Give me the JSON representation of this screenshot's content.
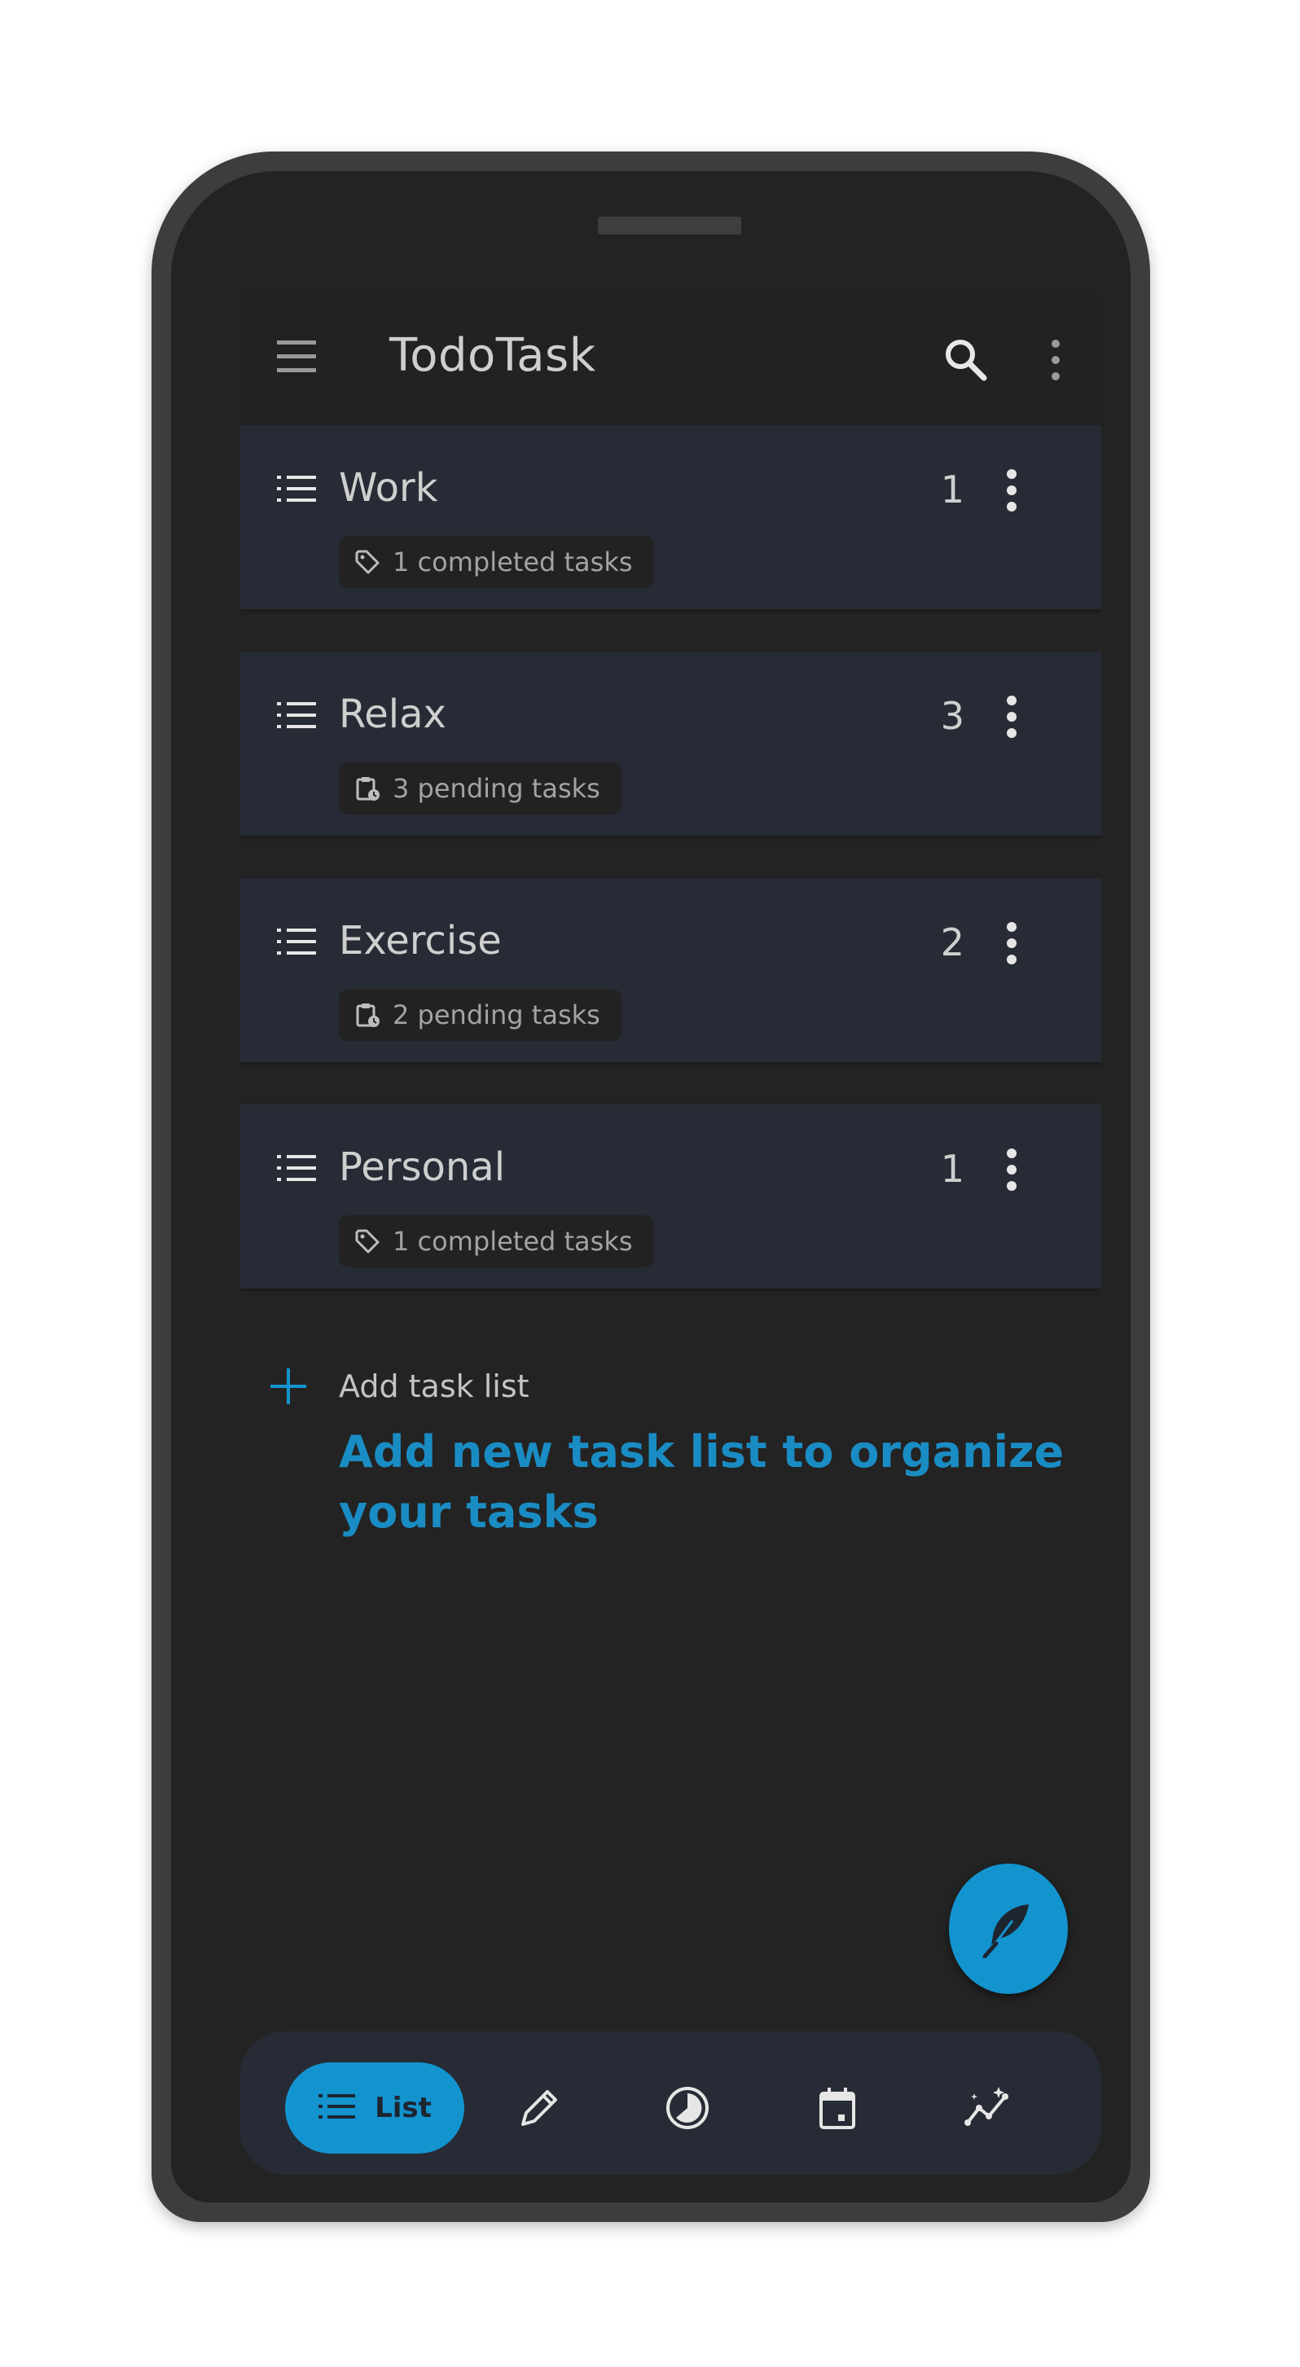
{
  "app": {
    "title": "TodoTask"
  },
  "lists": [
    {
      "name": "Work",
      "count": "1",
      "status_label": "1 completed tasks",
      "status_icon": "tag-icon"
    },
    {
      "name": "Relax",
      "count": "3",
      "status_label": "3 pending tasks",
      "status_icon": "pending-clipboard-icon"
    },
    {
      "name": "Exercise",
      "count": "2",
      "status_label": "2 pending tasks",
      "status_icon": "pending-clipboard-icon"
    },
    {
      "name": "Personal",
      "count": "1",
      "status_label": "1 completed tasks",
      "status_icon": "tag-icon"
    }
  ],
  "add_list": {
    "label": "Add task list",
    "description": "Add new task list to organize your tasks"
  },
  "bottom_nav": {
    "items": [
      {
        "label": "List",
        "icon": "list-icon",
        "active": true
      },
      {
        "label": "",
        "icon": "pencil-icon",
        "active": false
      },
      {
        "label": "",
        "icon": "pie-chart-icon",
        "active": false
      },
      {
        "label": "",
        "icon": "calendar-icon",
        "active": false
      },
      {
        "label": "",
        "icon": "sparkle-chart-icon",
        "active": false
      }
    ]
  },
  "fab": {
    "icon": "feather-icon"
  },
  "colors": {
    "accent": "#1394cf",
    "accent_text": "#1a8cc4",
    "background": "#232323",
    "card": "#272b35",
    "chip": "#222222"
  }
}
